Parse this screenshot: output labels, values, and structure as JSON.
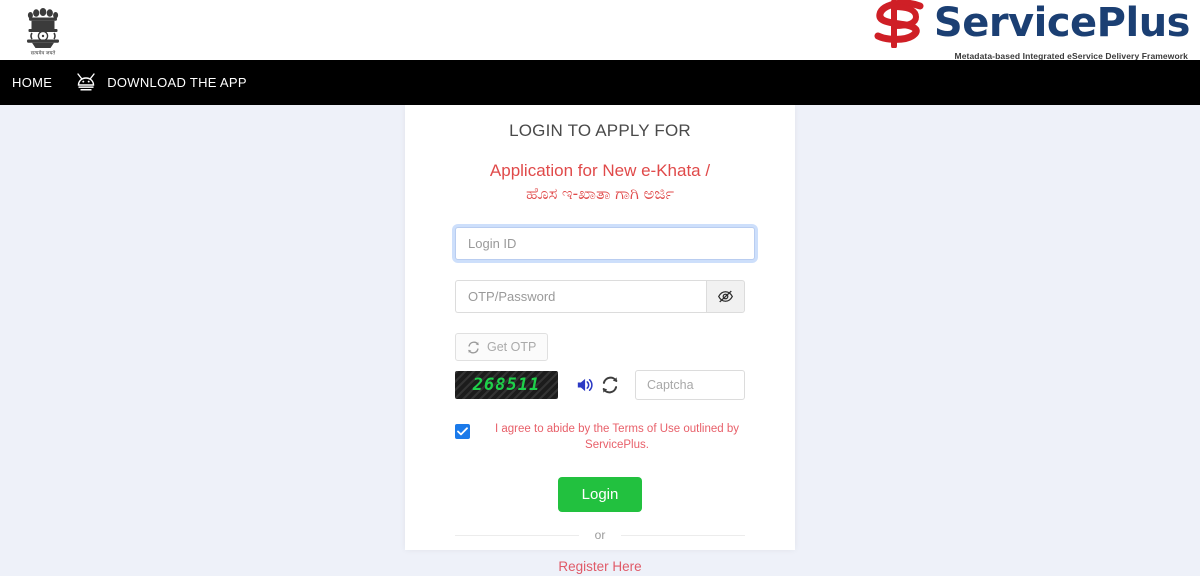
{
  "header": {
    "emblem_alt": "national-emblem-of-india",
    "brand_name": "ServicePlus",
    "brand_tagline": "Metadata-based Integrated eService Delivery Framework"
  },
  "navbar": {
    "home_label": "HOME",
    "download_app_label": "DOWNLOAD THE APP",
    "background_color": "#000000"
  },
  "login_card": {
    "title": "LOGIN TO APPLY FOR",
    "service_name_en": "Application for New e-Khata /",
    "service_name_kn": "ಹೊಸ ಇ-ಖಾತಾ ಗಾಗಿ ಅರ್ಜಿ",
    "login_id": {
      "placeholder": "Login ID",
      "value": "",
      "focused": true
    },
    "password": {
      "placeholder": "OTP/Password",
      "value": "",
      "toggle_icon": "eye-slash-icon"
    },
    "get_otp": {
      "label": "Get OTP",
      "icon": "refresh-icon",
      "disabled": true
    },
    "captcha": {
      "code": "268511",
      "code_color": "#1ed04a",
      "background_color": "#1c1c1c",
      "audio_icon": "speaker-icon",
      "refresh_icon": "refresh-icon",
      "input_placeholder": "Captcha",
      "input_value": ""
    },
    "terms": {
      "checked": true,
      "text": "I agree to abide by the Terms of Use outlined by ServicePlus.",
      "text_color": "#e8606a",
      "checkbox_color": "#1b7aea"
    },
    "login_button": {
      "label": "Login",
      "color": "#22c13f"
    },
    "divider_label": "or",
    "register_link": "Register Here",
    "register_link_color": "#e05a68"
  },
  "page": {
    "background_color": "#eef1f9",
    "card_background": "#ffffff"
  }
}
